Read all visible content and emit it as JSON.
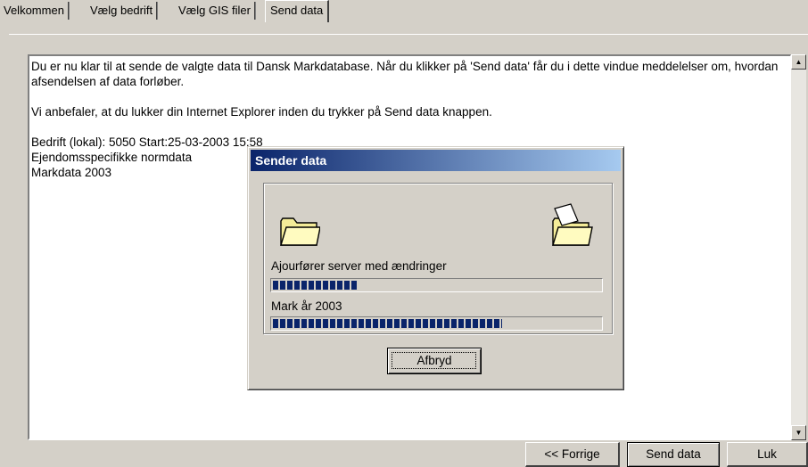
{
  "tabs": [
    "Velkommen",
    "Vælg bedrift",
    "Vælg GIS filer",
    "Send data"
  ],
  "active_tab": "Send data",
  "main": {
    "intro": "Du er nu klar til at sende de valgte data til Dansk Markdatabase. Når du klikker på 'Send data' får du i dette vindue meddelelser om, hvordan afsendelsen af data forløber.",
    "advice": "Vi anbefaler, at du lukker din Internet Explorer inden du trykker på Send data knappen.",
    "status_lines": [
      "Bedrift (lokal): 5050 Start:25-03-2003 15:58",
      "Ejendomsspecifikke normdata",
      "Markdata 2003"
    ]
  },
  "buttons": {
    "prev": "<< Forrige",
    "send": "Send data",
    "close": "Luk"
  },
  "dialog": {
    "title": "Sender data",
    "step1_label": "Ajourfører server med ændringer",
    "step1_progress": 0.26,
    "step2_label": "Mark år 2003",
    "step2_progress": 0.7,
    "cancel": "Afbryd"
  },
  "icons": {
    "folder_left": "folder-icon",
    "folder_right": "folder-document-icon",
    "scroll_up": "scroll-up-arrow-icon",
    "scroll_down": "scroll-down-arrow-icon"
  },
  "colors": {
    "title_gradient_start": "#0a246a",
    "title_gradient_end": "#a6caf0",
    "progress": "#0a246a",
    "window_bg": "#d4d0c8"
  }
}
